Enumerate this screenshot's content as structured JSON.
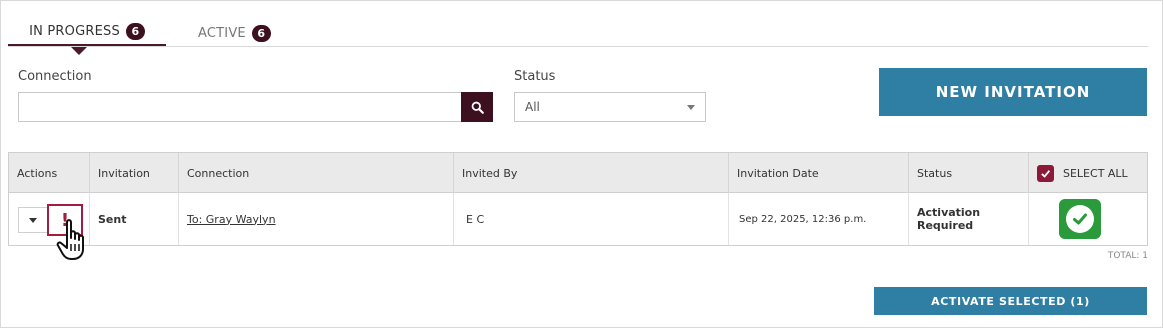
{
  "tabs": [
    {
      "label": "IN PROGRESS",
      "count": "6",
      "active": true
    },
    {
      "label": "ACTIVE",
      "count": "6",
      "active": false
    }
  ],
  "filters": {
    "connection_label": "Connection",
    "connection_value": "",
    "status_label": "Status",
    "status_value": "All"
  },
  "new_invitation_label": "NEW INVITATION",
  "table": {
    "headers": {
      "actions": "Actions",
      "invitation": "Invitation",
      "connection": "Connection",
      "invited_by": "Invited By",
      "invitation_date": "Invitation Date",
      "status": "Status",
      "select_all": "SELECT ALL"
    },
    "rows": [
      {
        "alert_glyph": "!",
        "invitation": "Sent",
        "connection": "To: Gray Waylyn",
        "invited_by": "E C",
        "invitation_date": "Sep 22, 2025, 12:36 p.m.",
        "status": "Activation Required"
      }
    ],
    "total": "TOTAL: 1"
  },
  "activate_selected_label": "ACTIVATE SELECTED (1)",
  "colors": {
    "brand_dark": "#3d1020",
    "accent_blue": "#2f7ea3",
    "alert_red": "#a31d3f",
    "checkbox_maroon": "#8a1a38",
    "success_green": "#2a9a3a"
  },
  "icons": {
    "search": "search-icon",
    "caret": "chevron-down-icon",
    "alert": "alert-icon",
    "cursor": "hand-pointer-icon",
    "check": "check-icon"
  }
}
